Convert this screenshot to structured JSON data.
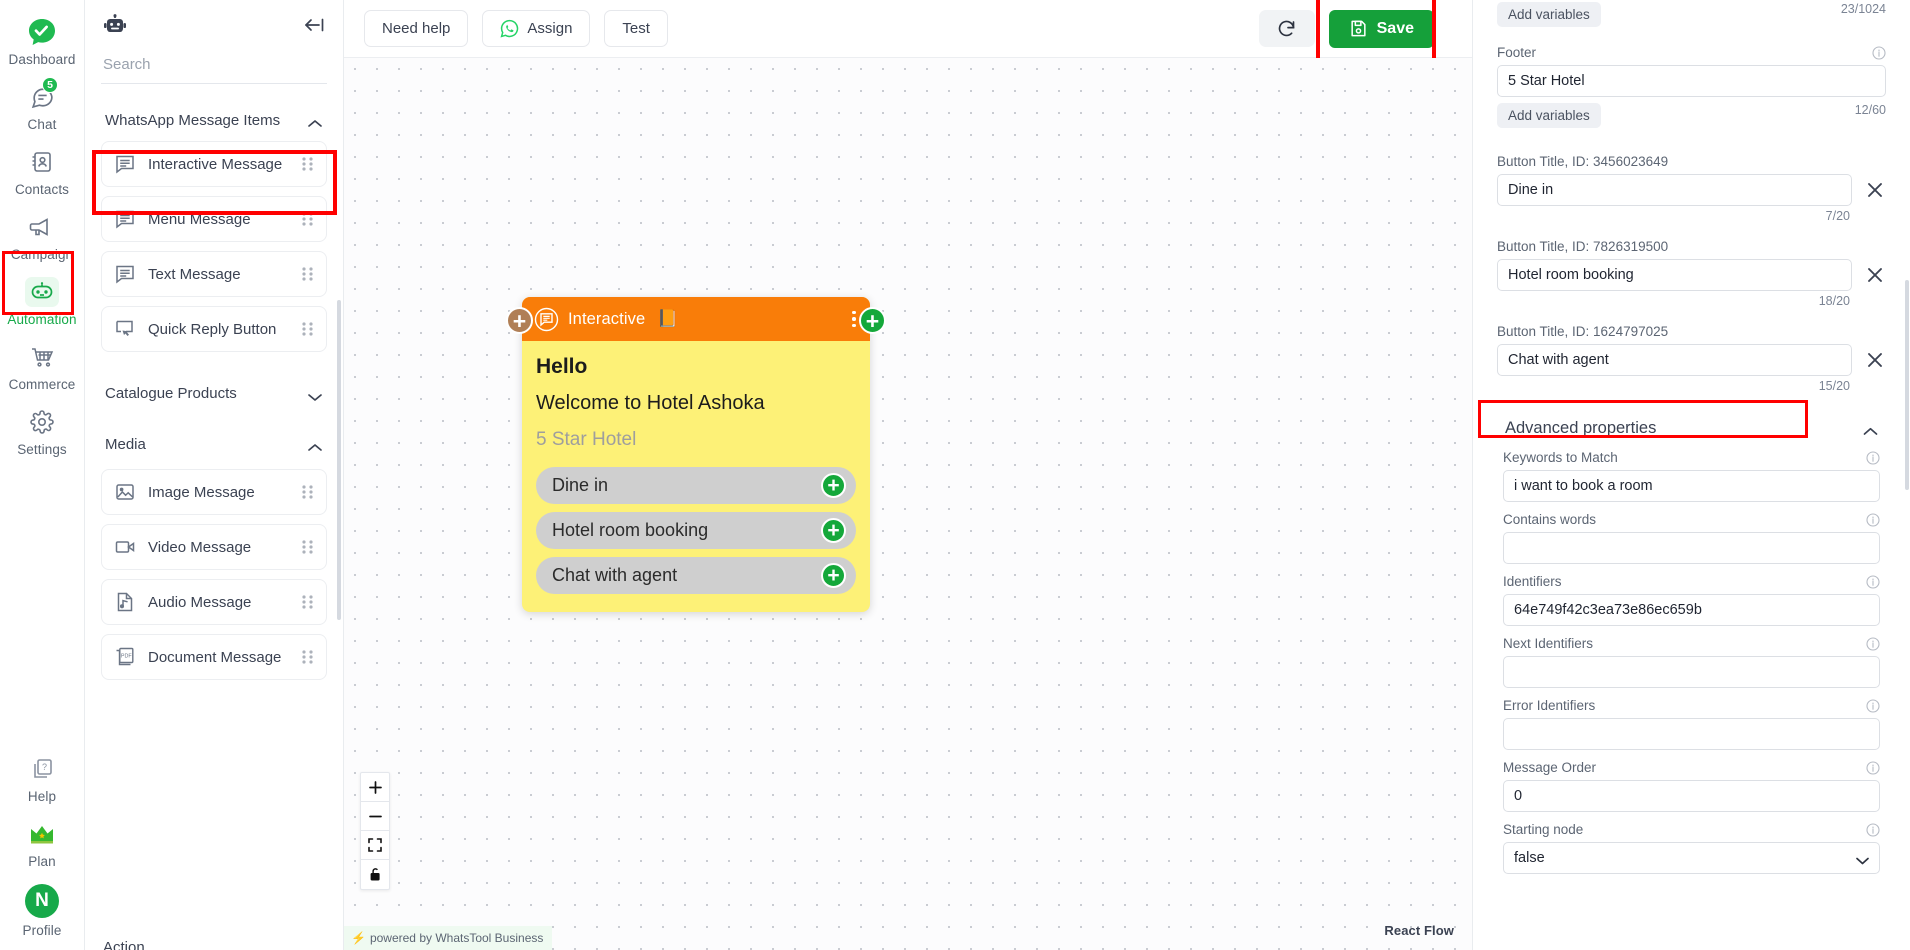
{
  "rail": {
    "items": [
      {
        "label": "Dashboard",
        "icon": "whatstool-logo-icon",
        "badge": null,
        "active": false
      },
      {
        "label": "Chat",
        "icon": "chat-bubble-icon",
        "badge": "5",
        "active": false
      },
      {
        "label": "Contacts",
        "icon": "contacts-icon",
        "badge": null,
        "active": false
      },
      {
        "label": "Campaign",
        "icon": "megaphone-icon",
        "badge": null,
        "active": false
      },
      {
        "label": "Automation",
        "icon": "robot-icon",
        "badge": null,
        "active": true
      },
      {
        "label": "Commerce",
        "icon": "shopping-cart-icon",
        "badge": null,
        "active": false
      },
      {
        "label": "Settings",
        "icon": "gear-icon",
        "badge": null,
        "active": false
      }
    ],
    "bottom_items": [
      {
        "label": "Help",
        "icon": "help-question-icon"
      },
      {
        "label": "Plan",
        "icon": "crown-icon"
      },
      {
        "label": "Profile",
        "icon": "avatar-icon",
        "avatar_letter": "N"
      }
    ]
  },
  "panel": {
    "bot_icon": "robot-head-icon",
    "collapse_icon": "collapse-left-icon",
    "search": {
      "placeholder": "Search",
      "value": ""
    },
    "sections": [
      {
        "title": "WhatsApp Message Items",
        "expanded": true,
        "chevron": "chevron-up-icon",
        "items": [
          {
            "label": "Interactive Message",
            "icon": "message-lines-icon",
            "highlighted": true
          },
          {
            "label": "Menu Message",
            "icon": "message-lines-icon",
            "highlighted": false
          },
          {
            "label": "Text Message",
            "icon": "message-lines-icon",
            "highlighted": false
          },
          {
            "label": "Quick Reply Button",
            "icon": "quick-reply-icon",
            "highlighted": false
          }
        ]
      },
      {
        "title": "Catalogue Products",
        "expanded": false,
        "chevron": "chevron-down-icon",
        "items": []
      },
      {
        "title": "Media",
        "expanded": true,
        "chevron": "chevron-up-icon",
        "items": [
          {
            "label": "Image Message",
            "icon": "image-icon",
            "highlighted": false
          },
          {
            "label": "Video Message",
            "icon": "video-camera-icon",
            "highlighted": false
          },
          {
            "label": "Audio Message",
            "icon": "audio-note-icon",
            "highlighted": false
          },
          {
            "label": "Document Message",
            "icon": "pdf-document-icon",
            "highlighted": false
          }
        ]
      }
    ],
    "next_section_peek": "Action"
  },
  "toolbar": {
    "need_help": "Need help",
    "assign": "Assign",
    "assign_icon": "whatsapp-icon",
    "test": "Test",
    "refresh_icon": "refresh-icon",
    "save": "Save",
    "save_icon": "floppy-disk-icon",
    "save_color": "#15a03a"
  },
  "canvas": {
    "node": {
      "header_title": "Interactive",
      "header_icon": "interactive-message-icon",
      "header_flag": "📙",
      "header_color": "#f97d09",
      "body_color": "#fdf177",
      "menu_icon": "kebab-menu-icon",
      "left_handle": "add-handle-left",
      "right_handle": "add-handle-right",
      "heading": "Hello",
      "body_text": "Welcome to Hotel Ashoka",
      "footer_text": "5 Star Hotel",
      "buttons": [
        {
          "label": "Dine in",
          "handle": "add-handle"
        },
        {
          "label": "Hotel room booking",
          "handle": "add-handle"
        },
        {
          "label": "Chat with agent",
          "handle": "add-handle"
        }
      ]
    },
    "controls": [
      {
        "name": "zoom-in",
        "glyph": "+"
      },
      {
        "name": "zoom-out",
        "glyph": "−"
      },
      {
        "name": "fit-view",
        "glyph": "fit-icon"
      },
      {
        "name": "lock",
        "glyph": "lock-icon"
      }
    ],
    "powered_by": "powered by WhatsTool Business",
    "brand": "React Flow"
  },
  "right_panel": {
    "body_counter": "23/1024",
    "body_add_variables": "Add variables",
    "footer_label": "Footer",
    "footer_value": "5 Star Hotel",
    "footer_counter": "12/60",
    "footer_add_variables": "Add variables",
    "buttons": [
      {
        "label": "Button Title, ID: 3456023649",
        "value": "Dine in",
        "counter": "7/20",
        "remove_icon": "close-x-icon"
      },
      {
        "label": "Button Title, ID: 7826319500",
        "value": "Hotel room booking",
        "counter": "18/20",
        "remove_icon": "close-x-icon"
      },
      {
        "label": "Button Title, ID: 1624797025",
        "value": "Chat with agent",
        "counter": "15/20",
        "remove_icon": "close-x-icon"
      }
    ],
    "advanced": {
      "title": "Advanced properties",
      "chevron": "chevron-up-icon",
      "fields": [
        {
          "label": "Keywords to Match",
          "value": "i want to book a room",
          "type": "text",
          "highlighted": true
        },
        {
          "label": "Contains words",
          "value": "",
          "type": "text",
          "highlighted": false
        },
        {
          "label": "Identifiers",
          "value": "64e749f42c3ea73e86ec659b",
          "type": "text",
          "highlighted": false
        },
        {
          "label": "Next Identifiers",
          "value": "",
          "type": "text",
          "highlighted": false
        },
        {
          "label": "Error Identifiers",
          "value": "",
          "type": "text",
          "highlighted": false
        },
        {
          "label": "Message Order",
          "value": "0",
          "type": "text",
          "highlighted": false
        },
        {
          "label": "Starting node",
          "value": "false",
          "type": "select",
          "highlighted": false
        }
      ]
    }
  },
  "colors": {
    "accent_green": "#15a03a",
    "node_orange": "#f97d09",
    "node_yellow": "#fdf177",
    "highlight_red": "#ff0000"
  }
}
